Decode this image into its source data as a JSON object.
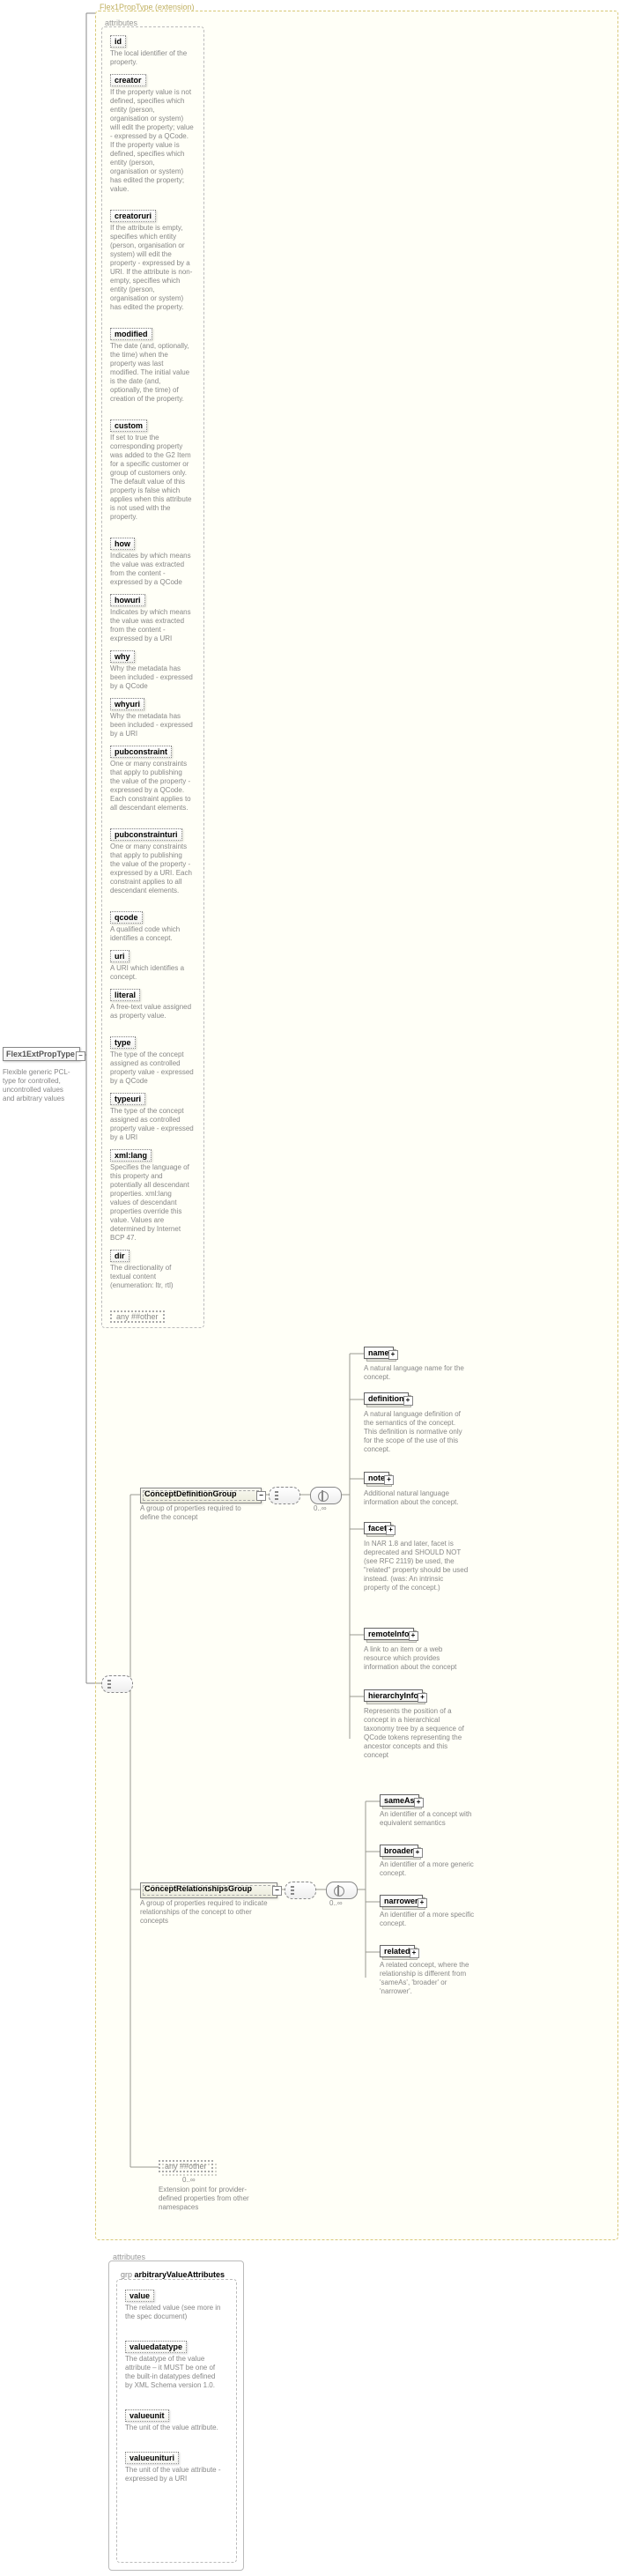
{
  "root": {
    "name": "Flex1ExtPropType",
    "caption": "Flexible generic PCL-type for controlled, uncontrolled values and arbitrary values"
  },
  "extension_label": "Flex1PropType (extension)",
  "attributes_label": "attributes",
  "attrs": [
    {
      "name": "id",
      "desc": "The local identifier of the property."
    },
    {
      "name": "creator",
      "desc": "If the property value is not defined, specifies which entity (person, organisation or system) will edit the property; value - expressed by a QCode. If the property value is defined, specifies which entity (person, organisation or system) has edited the property; value."
    },
    {
      "name": "creatoruri",
      "desc": "If the attribute is empty, specifies which entity (person, organisation or system) will edit the property - expressed by a URI. If the attribute is non-empty, specifies which entity (person, organisation or system) has edited the property."
    },
    {
      "name": "modified",
      "desc": "The date (and, optionally, the time) when the property was last modified. The initial value is the date (and, optionally, the time) of creation of the property."
    },
    {
      "name": "custom",
      "desc": "If set to true the corresponding property was added to the G2 Item for a specific customer or group of customers only. The default value of this property is false which applies when this attribute is not used with the property."
    },
    {
      "name": "how",
      "desc": "Indicates by which means the value was extracted from the content - expressed by a QCode"
    },
    {
      "name": "howuri",
      "desc": "Indicates by which means the value was extracted from the content - expressed by a URI"
    },
    {
      "name": "why",
      "desc": "Why the metadata has been included - expressed by a QCode"
    },
    {
      "name": "whyuri",
      "desc": "Why the metadata has been included - expressed by a URI"
    },
    {
      "name": "pubconstraint",
      "desc": "One or many constraints that apply to publishing the value of the property - expressed by a QCode. Each constraint applies to all descendant elements."
    },
    {
      "name": "pubconstrainturi",
      "desc": "One or many constraints that apply to publishing the value of the property - expressed by a URI. Each constraint applies to all descendant elements."
    },
    {
      "name": "qcode",
      "desc": "A qualified code which identifies a concept."
    },
    {
      "name": "uri",
      "desc": "A URI which identifies a concept."
    },
    {
      "name": "literal",
      "desc": "A free-text value assigned as property value."
    },
    {
      "name": "type",
      "desc": "The type of the concept assigned as controlled property value - expressed by a QCode"
    },
    {
      "name": "typeuri",
      "desc": "The type of the concept assigned as controlled property value - expressed by a URI"
    },
    {
      "name": "xml:lang",
      "desc": "Specifies the language of this property and potentially all descendant properties. xml:lang values of descendant properties override this value. Values are determined by Internet BCP 47."
    },
    {
      "name": "dir",
      "desc": "The directionality of textual content (enumeration: ltr, rtl)"
    }
  ],
  "any_attr": "any ##other",
  "group1": {
    "name": "ConceptDefinitionGroup",
    "desc": "A group of properties required to define the concept",
    "occ": "0..∞",
    "children": [
      {
        "name": "name",
        "desc": "A natural language name for the concept."
      },
      {
        "name": "definition",
        "desc": "A natural language definition of the semantics of the concept. This definition is normative only for the scope of the use of this concept."
      },
      {
        "name": "note",
        "desc": "Additional natural language information about the concept."
      },
      {
        "name": "facet",
        "desc": "In NAR 1.8 and later, facet is deprecated and SHOULD NOT (see RFC 2119) be used, the \"related\" property should be used instead. (was: An intrinsic property of the concept.)"
      },
      {
        "name": "remoteInfo",
        "desc": "A link to an item or a web resource which provides information about the concept"
      },
      {
        "name": "hierarchyInfo",
        "desc": "Represents the position of a concept in a hierarchical taxonomy tree by a sequence of QCode tokens representing the ancestor concepts and this concept"
      }
    ]
  },
  "group2": {
    "name": "ConceptRelationshipsGroup",
    "desc": "A group of properties required to indicate relationships of the concept to other concepts",
    "occ": "0..∞",
    "children": [
      {
        "name": "sameAs",
        "desc": "An identifier of a concept with equivalent semantics"
      },
      {
        "name": "broader",
        "desc": "An identifier of a more generic concept."
      },
      {
        "name": "narrower",
        "desc": "An identifier of a more specific concept."
      },
      {
        "name": "related",
        "desc": "A related concept, where the relationship is different from 'sameAs', 'broader' or 'narrower'."
      }
    ]
  },
  "any_elem": {
    "label": "any ##other",
    "occ": "0..∞",
    "desc": "Extension point for provider-defined properties from other namespaces"
  },
  "attrgrp2": {
    "label": "attributes",
    "grp_label": "grp",
    "grp_name": "arbitraryValueAttributes",
    "children": [
      {
        "name": "value",
        "desc": "The related value (see more in the spec document)"
      },
      {
        "name": "valuedatatype",
        "desc": "The datatype of the value attribute – it MUST be one of the built-in datatypes defined by XML Schema version 1.0."
      },
      {
        "name": "valueunit",
        "desc": "The unit of the value attribute."
      },
      {
        "name": "valueunituri",
        "desc": "The unit of the value attribute - expressed by a URI"
      }
    ]
  }
}
